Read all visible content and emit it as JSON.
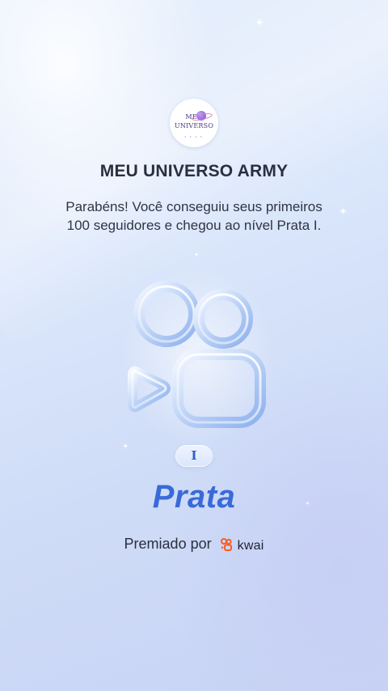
{
  "profile": {
    "avatar_line1": "MEU",
    "avatar_line2": "UNIVERSO",
    "avatar_dots": "• • • •",
    "name": "MEU UNIVERSO ARMY"
  },
  "message": {
    "line1": "Parabéns! Você conseguiu seus primeiros",
    "line2": "100 seguidores e chegou ao nível Prata I."
  },
  "badge": {
    "level": "I",
    "rank": "Prata",
    "icon": "kwai-camera-badge-icon"
  },
  "footer": {
    "awarded_by": "Premiado por",
    "brand": "kwai",
    "brand_icon": "kwai-logo-icon",
    "brand_color": "#FF5A1F"
  },
  "colors": {
    "accent": "#3A6AD8",
    "title": "#2A2F3F",
    "background_top": "#E9F1FD",
    "background_bottom": "#C7D3F4"
  }
}
